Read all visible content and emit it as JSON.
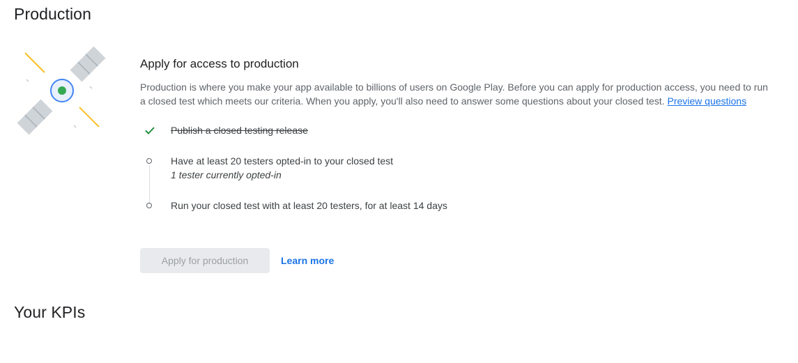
{
  "sections": {
    "production_title": "Production",
    "kpis_title": "Your KPIs"
  },
  "card": {
    "heading": "Apply for access to production",
    "description": "Production is where you make your app available to billions of users on Google Play. Before you can apply for production access, you need to run a closed test which meets our criteria. When you apply, you'll also need to answer some questions about your closed test.",
    "preview_link": "Preview questions"
  },
  "steps": [
    {
      "label": "Publish a closed testing release",
      "status": "done",
      "detail": ""
    },
    {
      "label": "Have at least 20 testers opted-in to your closed test",
      "status": "pending",
      "detail": "1 tester currently opted-in"
    },
    {
      "label": "Run your closed test with at least 20 testers, for at least 14 days",
      "status": "pending",
      "detail": ""
    }
  ],
  "actions": {
    "apply_label": "Apply for production",
    "learn_more_label": "Learn more"
  },
  "colors": {
    "accent": "#1a73e8",
    "check": "#1e8e3e",
    "disabled_bg": "#e8eaed",
    "disabled_text": "#9aa0a6"
  }
}
